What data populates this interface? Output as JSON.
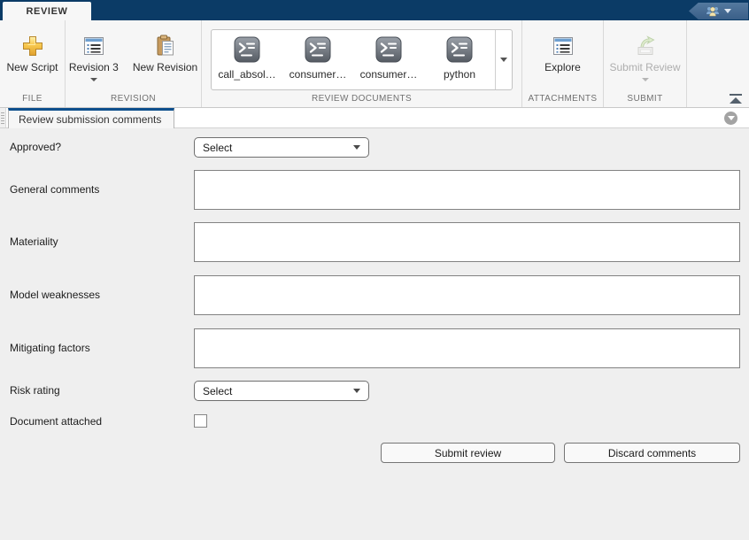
{
  "colors": {
    "banner_blue": "#0b3b66",
    "tab_accent_blue": "#0d4e8c",
    "user_button_blue": "#3a5f88",
    "toolstrip_bg": "#f6f6f6",
    "form_bg": "#efefef",
    "disabled_text": "#aeaeae"
  },
  "banner": {
    "active_tab": "REVIEW",
    "user_button_icon": "community-users-icon"
  },
  "toolstrip": {
    "file": {
      "label": "FILE",
      "new_script": "New Script"
    },
    "revision": {
      "label": "REVISION",
      "revision_dropdown": "Revision 3",
      "new_revision": "New Revision"
    },
    "review_documents": {
      "label": "REVIEW DOCUMENTS",
      "items": [
        {
          "label": "call_absol…",
          "icon": "script-terminal-icon"
        },
        {
          "label": "consumer…",
          "icon": "script-terminal-icon"
        },
        {
          "label": "consumer…",
          "icon": "script-terminal-icon"
        },
        {
          "label": "python",
          "icon": "script-terminal-icon"
        }
      ]
    },
    "attachments": {
      "label": "ATTACHMENTS",
      "explore": "Explore"
    },
    "submit": {
      "label": "SUBMIT",
      "submit_review": "Submit Review",
      "enabled": false
    }
  },
  "panel": {
    "tab_title": "Review submission comments"
  },
  "form": {
    "approved": {
      "label": "Approved?",
      "value": "Select"
    },
    "general_comments": {
      "label": "General comments",
      "value": ""
    },
    "materiality": {
      "label": "Materiality",
      "value": ""
    },
    "model_weaknesses": {
      "label": "Model weaknesses",
      "value": ""
    },
    "mitigating_factors": {
      "label": "Mitigating factors",
      "value": ""
    },
    "risk_rating": {
      "label": "Risk rating",
      "value": "Select"
    },
    "document_attached": {
      "label": "Document attached",
      "checked": false
    },
    "buttons": {
      "submit": "Submit review",
      "discard": "Discard comments"
    }
  }
}
